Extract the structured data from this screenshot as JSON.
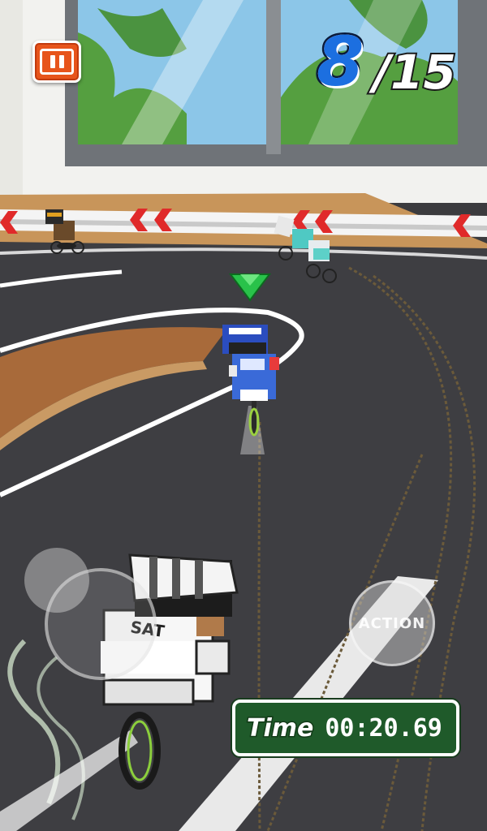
{
  "hud": {
    "rank_position": "8",
    "rank_total": "/15",
    "time_label": "Time",
    "time_value": "00:20.69",
    "action_label": "ACTION"
  },
  "icons": {
    "pause": "pause-icon",
    "marker": "green-triangle-marker-icon"
  },
  "colors": {
    "pause_button": "#e7541b",
    "rank_number": "#1c6fe0",
    "time_panel": "#1f5a2a",
    "track": "#3b3b3e",
    "marker": "#29c24a"
  }
}
